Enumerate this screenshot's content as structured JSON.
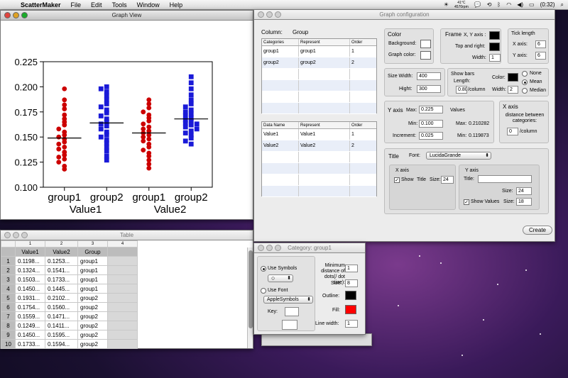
{
  "menubar": {
    "app_name": "ScatterMaker",
    "items": [
      "File",
      "Edit",
      "Tools",
      "Window",
      "Help"
    ],
    "weather_temp": "41°C",
    "weather_rpm": "4570rpm",
    "battery": "(0:32)"
  },
  "graph_view": {
    "title": "Graph View",
    "chart_data": {
      "type": "scatter",
      "ylim": [
        0.1,
        0.225
      ],
      "yticks": [
        "0.225",
        "0.200",
        "0.175",
        "0.150",
        "0.125",
        "0.100"
      ],
      "ytick_values": [
        0.225,
        0.2,
        0.175,
        0.15,
        0.125,
        0.1
      ],
      "categories": [
        "group1",
        "group2",
        "group1",
        "group2"
      ],
      "value_labels": [
        "Value1",
        "Value2"
      ],
      "series": [
        {
          "color": "#cc0000",
          "shape": "circle",
          "mean": 0.149,
          "points": [
            0.198,
            0.187,
            0.182,
            0.178,
            0.172,
            0.168,
            0.165,
            0.162,
            0.158,
            0.155,
            0.152,
            0.15,
            0.148,
            0.145,
            0.143,
            0.14,
            0.138,
            0.135,
            0.132,
            0.13,
            0.128,
            0.125,
            0.121,
            0.118
          ]
        },
        {
          "color": "#1a1ad8",
          "shape": "square",
          "mean": 0.164,
          "points": [
            0.2,
            0.198,
            0.195,
            0.191,
            0.187,
            0.183,
            0.18,
            0.177,
            0.174,
            0.171,
            0.168,
            0.165,
            0.163,
            0.161,
            0.158,
            0.155,
            0.152,
            0.15,
            0.147,
            0.144,
            0.14,
            0.136,
            0.131,
            0.127
          ]
        },
        {
          "color": "#cc0000",
          "shape": "circle",
          "mean": 0.154,
          "points": [
            0.187,
            0.183,
            0.179,
            0.175,
            0.172,
            0.169,
            0.166,
            0.163,
            0.16,
            0.158,
            0.156,
            0.154,
            0.152,
            0.15,
            0.148,
            0.146,
            0.143,
            0.14,
            0.137,
            0.134,
            0.131,
            0.127,
            0.123,
            0.119
          ]
        },
        {
          "color": "#1a1ad8",
          "shape": "square",
          "mean": 0.168,
          "points": [
            0.21,
            0.204,
            0.198,
            0.192,
            0.187,
            0.183,
            0.18,
            0.177,
            0.175,
            0.173,
            0.171,
            0.169,
            0.167,
            0.166,
            0.164,
            0.163,
            0.162,
            0.16,
            0.158,
            0.156,
            0.154,
            0.152,
            0.149,
            0.146,
            0.143
          ]
        }
      ]
    }
  },
  "table": {
    "title": "Table",
    "col_numbers": [
      "1",
      "2",
      "3",
      "4"
    ],
    "headers": [
      "Value1",
      "Value2",
      "Group",
      ""
    ],
    "rows": [
      [
        "1",
        "0.1198...",
        "0.1253...",
        "group1"
      ],
      [
        "2",
        "0.1324...",
        "0.1541...",
        "group1"
      ],
      [
        "3",
        "0.1503...",
        "0.1733...",
        "group1"
      ],
      [
        "4",
        "0.1450...",
        "0.1445...",
        "group1"
      ],
      [
        "5",
        "0.1931...",
        "0.2102...",
        "group2"
      ],
      [
        "6",
        "0.1754...",
        "0.1560...",
        "group2"
      ],
      [
        "7",
        "0.1559...",
        "0.1471...",
        "group2"
      ],
      [
        "8",
        "0.1249...",
        "0.1411...",
        "group2"
      ],
      [
        "9",
        "0.1450...",
        "0.1595...",
        "group2"
      ],
      [
        "10",
        "0.1733...",
        "0.1594...",
        "group2"
      ]
    ]
  },
  "config": {
    "title": "Graph configuration",
    "column_label": "Column:",
    "column_value": "Group",
    "cat_headers": [
      "Categories",
      "Represent",
      "Order"
    ],
    "cat_rows": [
      [
        "group1",
        "group1",
        "1"
      ],
      [
        "group2",
        "group2",
        "2"
      ]
    ],
    "data_headers": [
      "Data Name",
      "Represent",
      "Order"
    ],
    "data_rows": [
      [
        "Value1",
        "Value1",
        "1"
      ],
      [
        "Value2",
        "Value2",
        "2"
      ]
    ],
    "color": {
      "title": "Color",
      "background": "Background:",
      "graph_color": "Graph color:"
    },
    "frame": {
      "title": "Frame",
      "xy_axis": "X, Y axis :",
      "top_right": "Top and right:",
      "width_label": "Width:",
      "width": "1"
    },
    "tick": {
      "title": "Tick length",
      "x_label": "X axis:",
      "x": "6",
      "y_label": "Y axis:",
      "y": "6"
    },
    "size": {
      "width_label": "Size Width:",
      "width": "400",
      "height_label": "Hight:",
      "height": "300"
    },
    "bars": {
      "title": "Show bars",
      "length_label": "Length:",
      "length": "0.80",
      "per_column": "/column",
      "color_label": "Color:",
      "width_label": "Width:",
      "width": "2",
      "options": [
        "None",
        "Mean",
        "Median"
      ]
    },
    "yaxis": {
      "title": "Y axis",
      "max_label": "Max:",
      "max": "0.225",
      "min_label": "Min:",
      "min": "0.100",
      "inc_label": "Increment:",
      "inc": "0.025",
      "values_label": "Values",
      "vmax_label": "Max:",
      "vmax": "0.210282",
      "vmin_label": "Min:",
      "vmin": "0.119873"
    },
    "xaxis": {
      "title": "X axis",
      "desc": "distance between categories:",
      "dist": "0",
      "per_column": "/column"
    },
    "title_section": {
      "title": "Title",
      "font_label": "Font:",
      "font": "LucidaGrande",
      "x_axis": "X axis",
      "show": "Show",
      "title_label": "Title",
      "size_label": "Size:",
      "x_size": "24",
      "y_axis": "Y axis",
      "y_title_label": "Title:",
      "y_size": "24",
      "show_values": "Show Values",
      "values_size": "18"
    },
    "create": "Create"
  },
  "category": {
    "title": "Category: group1",
    "use_symbols": "Use Symbols",
    "symbol": "○",
    "use_font": "Use Font",
    "font": "AppleSymbols",
    "key_label": "Key:",
    "min_dist": "Minimum distance of dots(/ dot size):",
    "min_dist_value": "1",
    "size_label": "Size:",
    "size": "8",
    "outline_label": "Outline:",
    "fill_label": "Fill:",
    "linewidth_label": "Line width:",
    "linewidth": "1",
    "outline_color": "#000000",
    "fill_color": "#ff0000"
  }
}
